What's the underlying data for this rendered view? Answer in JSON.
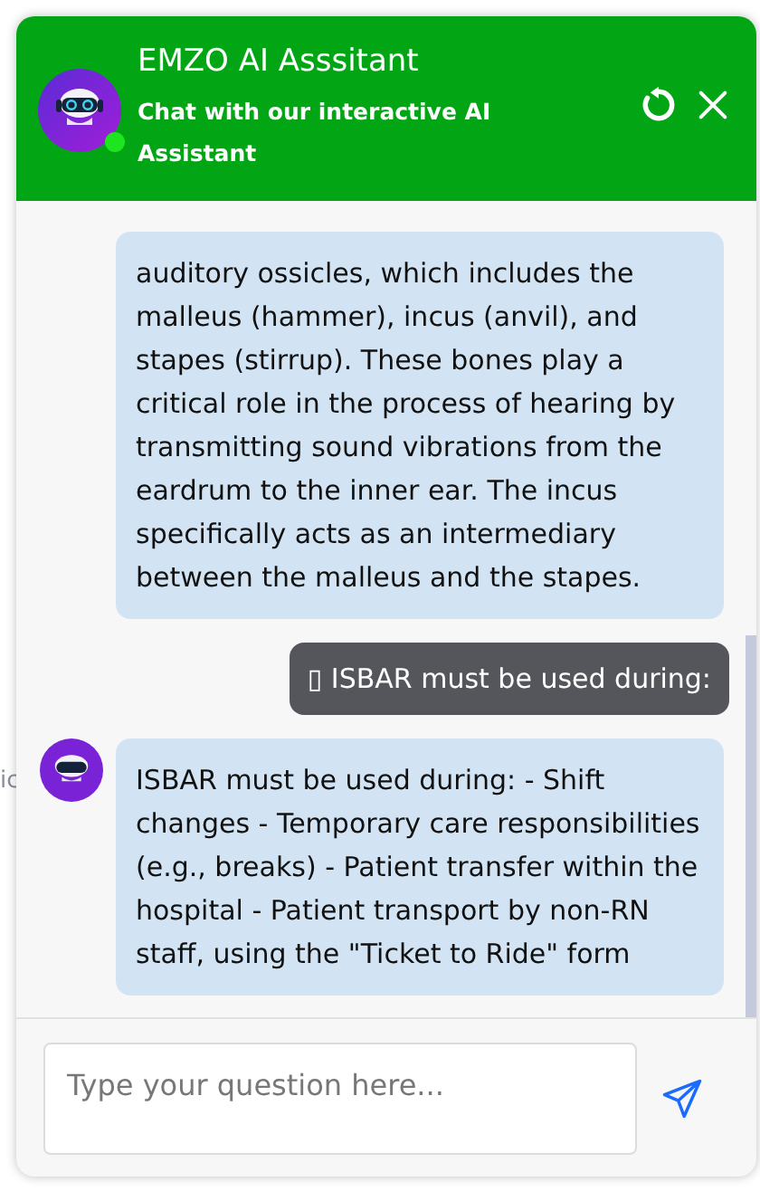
{
  "background_text": "ic",
  "header": {
    "title": "EMZO AI Asssitant",
    "subtitle": "Chat with our interactive AI Assistant",
    "online": true
  },
  "messages": [
    {
      "kind": "bot",
      "avatar": false,
      "text": "auditory ossicles, which includes the malleus (hammer), incus (anvil), and stapes (stirrup). These bones play a critical role in the process of hearing by transmitting sound vibrations from the eardrum to the inner ear. The incus specifically acts as an intermediary between the malleus and the stapes."
    },
    {
      "kind": "user",
      "text": "▯ ISBAR must be used during:"
    },
    {
      "kind": "bot",
      "avatar": true,
      "text": "ISBAR must be used during: - Shift changes - Temporary care responsibilities (e.g., breaks) - Patient transfer within the hospital - Patient transport by non-RN staff, using the \"Ticket to Ride\" form"
    }
  ],
  "input": {
    "placeholder": "Type your question here..."
  }
}
